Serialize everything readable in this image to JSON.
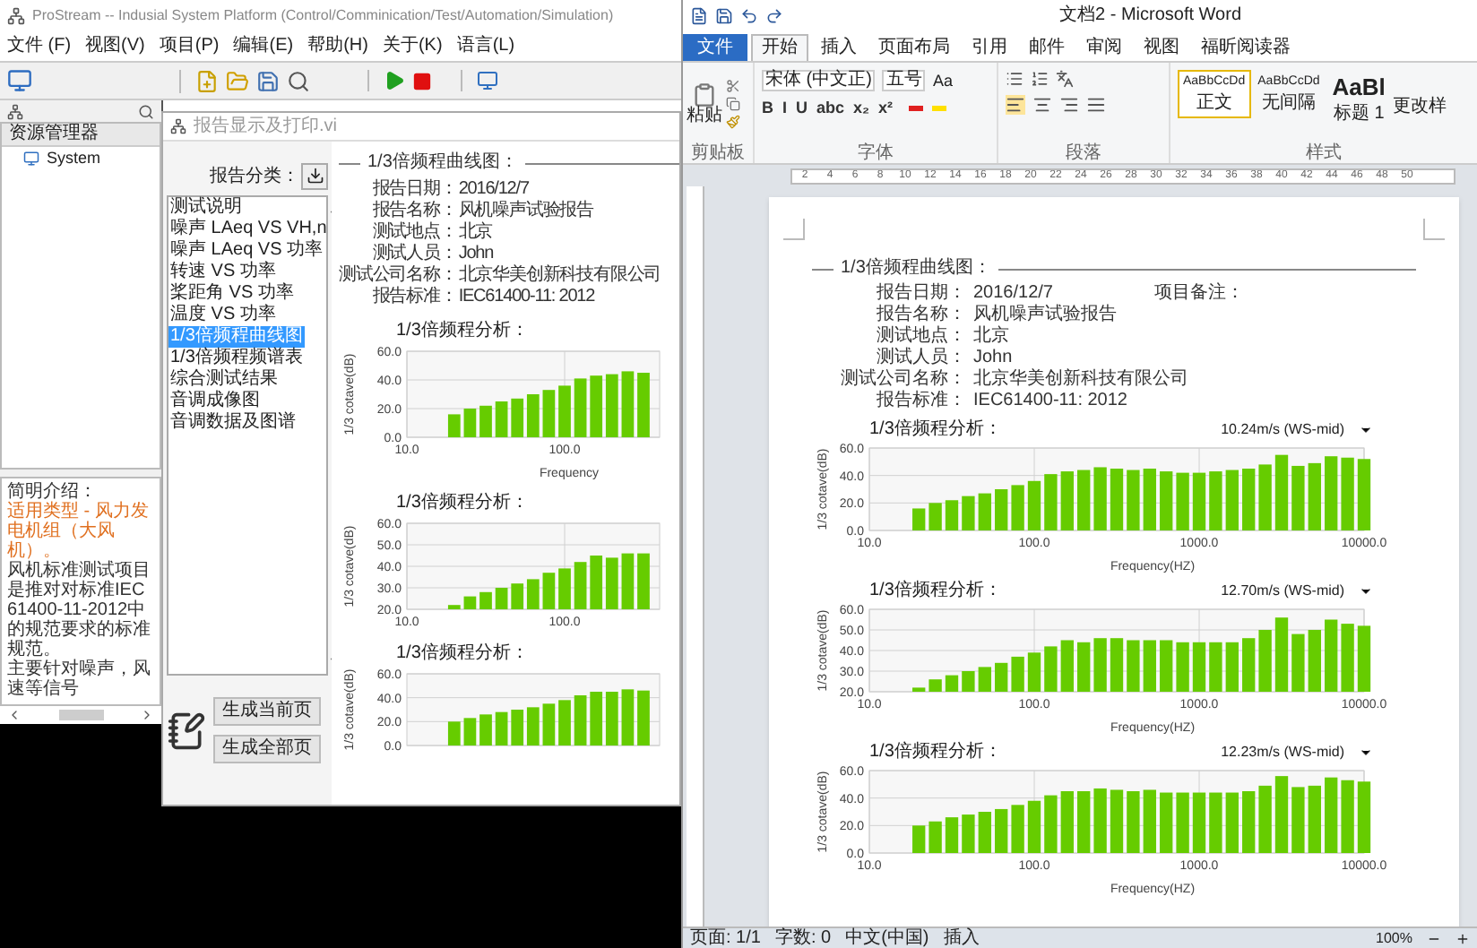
{
  "prostream": {
    "title": "ProStream -- Indusial System Platform (Control/Comminication/Test/Automation/Simulation)",
    "menu": [
      "文件 (F)",
      "视图(V)",
      "项目(P)",
      "编辑(E)",
      "帮助(H)",
      "关于(K)",
      "语言(L)"
    ],
    "explorer": {
      "title": "资源管理器",
      "items": [
        {
          "label": "System"
        }
      ]
    },
    "description": [
      {
        "kind": "heading",
        "text": "简明介绍："
      },
      {
        "kind": "highlight",
        "text": "适用类型 - 风力发电机组（大风机）。"
      },
      {
        "kind": "body",
        "text": "风机标准测试项目是推对对标准IEC61400-11-2012中的规范要求的标准规范。"
      },
      {
        "kind": "body",
        "text": "主要针对噪声，风速等信号"
      }
    ]
  },
  "dialog": {
    "title": "报告显示及打印.vi",
    "category_label": "报告分类：",
    "categories": [
      {
        "label": "测试说明",
        "selected": false
      },
      {
        "label": "噪声 LAeq VS VH,n",
        "selected": false
      },
      {
        "label": "噪声 LAeq VS 功率",
        "selected": false
      },
      {
        "label": "转速 VS 功率",
        "selected": false
      },
      {
        "label": "桨距角 VS 功率",
        "selected": false
      },
      {
        "label": "温度 VS 功率",
        "selected": false
      },
      {
        "label": "1/3倍频程曲线图",
        "selected": true
      },
      {
        "label": "1/3倍频程频谱表",
        "selected": false
      },
      {
        "label": "综合测试结果",
        "selected": false
      },
      {
        "label": "音调成像图",
        "selected": false
      },
      {
        "label": "音调数据及图谱",
        "selected": false
      }
    ],
    "buttons": [
      "生成当前页",
      "生成全部页"
    ],
    "report": {
      "section_title": "1/3倍频程曲线图：",
      "fields": [
        {
          "label": "报告日期：",
          "value": "2016/12/7"
        },
        {
          "label": "报告名称：",
          "value": "风机噪声试验报告"
        },
        {
          "label": "测试地点：",
          "value": "北京"
        },
        {
          "label": "测试人员：",
          "value": "John"
        },
        {
          "label": "测试公司名称：",
          "value": "北京华美创新科技有限公司"
        },
        {
          "label": "报告标准：",
          "value": "IEC61400-11: 2012"
        }
      ],
      "charts": [
        {
          "title": "1/3倍频程分析：",
          "chart_data": {
            "type": "bar",
            "xlabel": "Frequency",
            "ylabel": "1/3 cotave(dB)",
            "categories": [
              "10.0",
              null,
              null,
              null,
              null,
              null,
              null,
              null,
              null,
              null,
              "100.0",
              null,
              null,
              null,
              null,
              null
            ],
            "values": [
              null,
              null,
              null,
              16,
              20,
              22,
              25,
              27,
              30,
              33,
              36,
              41,
              43,
              44,
              46,
              45
            ],
            "grid": true,
            "ylim": [
              0,
              60
            ],
            "yticks": [
              {
                "value": 0,
                "label": "0.0"
              },
              {
                "value": 20,
                "label": "20.0"
              },
              {
                "value": 40,
                "label": "40.0"
              },
              {
                "value": 60,
                "label": "60.0"
              }
            ]
          }
        },
        {
          "title": "1/3倍频程分析：",
          "chart_data": {
            "type": "bar",
            "ylabel": "1/3 cotave(dB)",
            "categories": [
              "10.0",
              null,
              null,
              null,
              null,
              null,
              null,
              null,
              null,
              null,
              "100.0",
              null,
              null,
              null,
              null,
              null
            ],
            "values": [
              null,
              null,
              null,
              22,
              26,
              28,
              30,
              32,
              34,
              37,
              39,
              42,
              45,
              44,
              46,
              46
            ],
            "grid": true,
            "ylim": [
              20,
              60
            ],
            "yticks": [
              {
                "value": 20,
                "label": "20.0"
              },
              {
                "value": 30,
                "label": "30.0"
              },
              {
                "value": 40,
                "label": "40.0"
              },
              {
                "value": 50,
                "label": "50.0"
              },
              {
                "value": 60,
                "label": "60.0"
              }
            ]
          }
        },
        {
          "title": "1/3倍频程分析：",
          "chart_data": {
            "type": "bar",
            "ylabel": "1/3 cotave(dB)",
            "categories": [
              null,
              null,
              null,
              null,
              null,
              null,
              null,
              null,
              null,
              null,
              null,
              null,
              null,
              null,
              null,
              null
            ],
            "values": [
              null,
              null,
              null,
              20,
              23,
              26,
              28,
              30,
              32,
              35,
              38,
              42,
              45,
              45,
              47,
              46
            ],
            "grid": true,
            "ylim": [
              0,
              60
            ],
            "yticks": [
              {
                "value": 0,
                "label": "0.0"
              },
              {
                "value": 20,
                "label": "20.0"
              },
              {
                "value": 40,
                "label": "40.0"
              },
              {
                "value": 60,
                "label": "60.0"
              }
            ]
          }
        }
      ]
    }
  },
  "word": {
    "title": "文档2 - Microsoft Word",
    "tabs": [
      {
        "label": "文件",
        "kind": "file",
        "selected": false
      },
      {
        "label": "开始",
        "kind": "tab",
        "selected": true
      },
      {
        "label": "插入",
        "kind": "tab",
        "selected": false
      },
      {
        "label": "页面布局",
        "kind": "tab",
        "selected": false
      },
      {
        "label": "引用",
        "kind": "tab",
        "selected": false
      },
      {
        "label": "邮件",
        "kind": "tab",
        "selected": false
      },
      {
        "label": "审阅",
        "kind": "tab",
        "selected": false
      },
      {
        "label": "视图",
        "kind": "tab",
        "selected": false
      },
      {
        "label": "福昕阅读器",
        "kind": "tab",
        "selected": false
      }
    ],
    "ribbon": {
      "paste": "粘贴",
      "font_name": "宋体 (中文正)",
      "font_size": "五号",
      "change_case": "Aa",
      "font_buttons": [
        "B",
        "I",
        "U",
        "abc",
        "x₂",
        "x²"
      ],
      "styles": [
        {
          "sample": "AaBbCcDd",
          "name": "正文",
          "selected": true
        },
        {
          "sample": "AaBbCcDd",
          "name": "无间隔",
          "selected": false
        },
        {
          "sample": "AaBl",
          "name": "标题 1",
          "selected": false
        }
      ],
      "change_styles": "更改样",
      "groups": [
        "剪贴板",
        "字体",
        "段落",
        "样式"
      ]
    },
    "ruler": [
      "2",
      "4",
      "6",
      "8",
      "10",
      "12",
      "14",
      "16",
      "18",
      "20",
      "22",
      "24",
      "26",
      "28",
      "30",
      "32",
      "34",
      "36",
      "38",
      "40",
      "42",
      "44",
      "46",
      "48",
      "50"
    ],
    "document": {
      "section_title": "1/3倍频程曲线图：",
      "note_label": "项目备注：",
      "fields": [
        {
          "label": "报告日期：",
          "value": "2016/12/7"
        },
        {
          "label": "报告名称：",
          "value": "风机噪声试验报告"
        },
        {
          "label": "测试地点：",
          "value": "北京"
        },
        {
          "label": "测试人员：",
          "value": "John"
        },
        {
          "label": "测试公司名称：",
          "value": "北京华美创新科技有限公司"
        },
        {
          "label": "报告标准：",
          "value": "IEC61400-11: 2012"
        }
      ],
      "charts": [
        {
          "title": "1/3倍频程分析：",
          "speed": "10.24m/s (WS-mid)",
          "chart_data": {
            "type": "bar",
            "xlabel": "Frequency(HZ)",
            "ylabel": "1/3 cotave(dB)",
            "categories": [
              "10.0",
              null,
              null,
              null,
              null,
              null,
              null,
              null,
              null,
              null,
              "100.0",
              null,
              null,
              null,
              null,
              null,
              null,
              null,
              null,
              null,
              "1000.0",
              null,
              null,
              null,
              null,
              null,
              null,
              null,
              null,
              null,
              "10000.0"
            ],
            "values": [
              null,
              null,
              null,
              16,
              20,
              22,
              25,
              27,
              30,
              33,
              36,
              41,
              43,
              44,
              46,
              45,
              44,
              45,
              43,
              42,
              42,
              43,
              44,
              45,
              48,
              55,
              47,
              49,
              54,
              53,
              52
            ],
            "grid": true,
            "ylim": [
              0,
              60
            ],
            "yticks": [
              {
                "value": 0,
                "label": "0.0"
              },
              {
                "value": 20,
                "label": "20.0"
              },
              {
                "value": 40,
                "label": "40.0"
              },
              {
                "value": 60,
                "label": "60.0"
              }
            ]
          }
        },
        {
          "title": "1/3倍频程分析：",
          "speed": "12.70m/s (WS-mid)",
          "chart_data": {
            "type": "bar",
            "xlabel": "Frequency(HZ)",
            "ylabel": "1/3 cotave(dB)",
            "categories": [
              "10.0",
              null,
              null,
              null,
              null,
              null,
              null,
              null,
              null,
              null,
              "100.0",
              null,
              null,
              null,
              null,
              null,
              null,
              null,
              null,
              null,
              "1000.0",
              null,
              null,
              null,
              null,
              null,
              null,
              null,
              null,
              null,
              "10000.0"
            ],
            "values": [
              null,
              null,
              null,
              22,
              26,
              28,
              30,
              32,
              34,
              37,
              39,
              42,
              45,
              44,
              46,
              46,
              45,
              45,
              45,
              44,
              44,
              44,
              44,
              46,
              50,
              56,
              48,
              50,
              55,
              53,
              52
            ],
            "grid": true,
            "ylim": [
              20,
              60
            ],
            "yticks": [
              {
                "value": 20,
                "label": "20.0"
              },
              {
                "value": 30,
                "label": "30.0"
              },
              {
                "value": 40,
                "label": "40.0"
              },
              {
                "value": 50,
                "label": "50.0"
              },
              {
                "value": 60,
                "label": "60.0"
              }
            ]
          }
        },
        {
          "title": "1/3倍频程分析：",
          "speed": "12.23m/s (WS-mid)",
          "chart_data": {
            "type": "bar",
            "xlabel": "Frequency(HZ)",
            "ylabel": "1/3 cotave(dB)",
            "categories": [
              "10.0",
              null,
              null,
              null,
              null,
              null,
              null,
              null,
              null,
              null,
              "100.0",
              null,
              null,
              null,
              null,
              null,
              null,
              null,
              null,
              null,
              "1000.0",
              null,
              null,
              null,
              null,
              null,
              null,
              null,
              null,
              null,
              "10000.0"
            ],
            "values": [
              null,
              null,
              null,
              20,
              23,
              26,
              28,
              30,
              32,
              35,
              38,
              42,
              45,
              45,
              47,
              46,
              45,
              46,
              44,
              44,
              44,
              44,
              44,
              45,
              49,
              56,
              48,
              49,
              55,
              53,
              52
            ],
            "grid": true,
            "ylim": [
              0,
              60
            ],
            "yticks": [
              {
                "value": 0,
                "label": "0.0"
              },
              {
                "value": 20,
                "label": "20.0"
              },
              {
                "value": 40,
                "label": "40.0"
              },
              {
                "value": 60,
                "label": "60.0"
              }
            ]
          }
        }
      ]
    },
    "status_bar": {
      "page": "页面: 1/1",
      "words": "字数: 0",
      "language": "中文(中国)",
      "mode": "插入",
      "zoom": "100%"
    }
  }
}
